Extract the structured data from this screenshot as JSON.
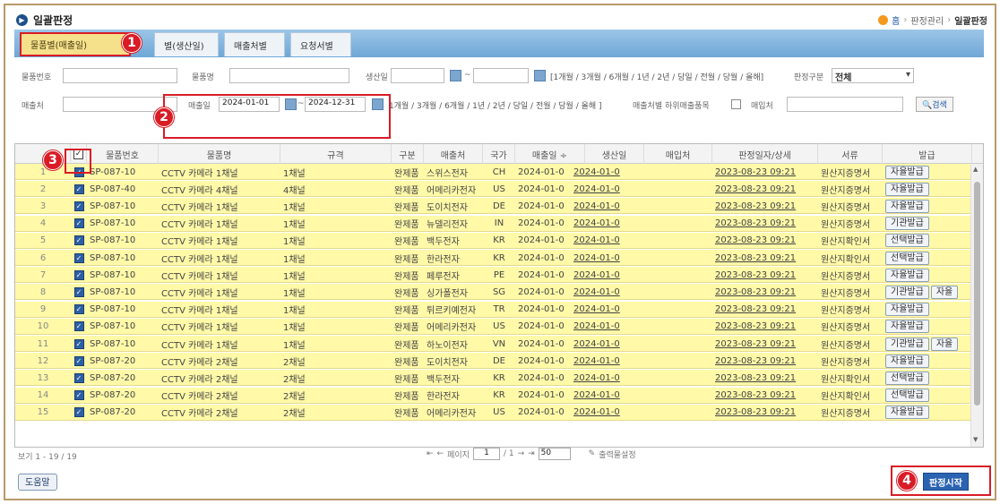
{
  "header": {
    "title": "일괄판정",
    "breadcrumb": {
      "home": "홈",
      "section": "판정관리",
      "current": "일괄판정"
    }
  },
  "tabs": [
    {
      "label": "물품별(매출일)"
    },
    {
      "label": "별(생산일)"
    },
    {
      "label": "매출처별"
    },
    {
      "label": "요청서별"
    }
  ],
  "badges": {
    "b1": "1",
    "b2": "2",
    "b3": "3",
    "b4": "4"
  },
  "filters": {
    "item_no_label": "물품번호",
    "item_name_label": "물품명",
    "prod_date_label": "생산일",
    "tilde": "~",
    "quick_ranges": "[1개월 / 3개월 / 6개월 / 1년 / 2년 / 당일 / 전월 / 당월 / 올해]",
    "judge_type_label": "판정구분",
    "judge_type_value": "전체",
    "buyer_label": "매출처",
    "sale_date_label": "매출일",
    "sale_date_from": "2024-01-01",
    "sale_date_to": "2024-12-31",
    "quick_ranges2": "1개월 / 3개월 / 6개월 / 1년 / 2년 / 당일 / 전월 / 당월 / 올해 ]",
    "sub_buyer_label": "매출처별 하위매출품목",
    "purchaser_label": "매입처",
    "search_label": "검색"
  },
  "grid": {
    "columns": [
      "물품번호",
      "물품명",
      "규격",
      "구분",
      "매출처",
      "국가",
      "매출일 ÷",
      "생산일",
      "매입처",
      "판정일자/상세",
      "서류",
      "발급"
    ],
    "rows": [
      {
        "n": "1",
        "item_no": "SP-087-10",
        "name": "CCTV 카메라 1채널",
        "spec": "1채널",
        "type": "완제품",
        "buyer": "스위스전자",
        "country": "CH",
        "sale": "2024-01-0",
        "prod": "2024-01-0",
        "judged": "2023-08-23 09:21",
        "doc": "원산지증명서",
        "issue": [
          "자율발급"
        ]
      },
      {
        "n": "2",
        "item_no": "SP-087-40",
        "name": "CCTV 카메라 4채널",
        "spec": "4채널",
        "type": "완제품",
        "buyer": "어메리카전자",
        "country": "US",
        "sale": "2024-01-0",
        "prod": "2024-01-0",
        "judged": "2023-08-23 09:21",
        "doc": "원산지증명서",
        "issue": [
          "자율발급"
        ]
      },
      {
        "n": "3",
        "item_no": "SP-087-10",
        "name": "CCTV 카메라 1채널",
        "spec": "1채널",
        "type": "완제품",
        "buyer": "도이치전자",
        "country": "DE",
        "sale": "2024-01-0",
        "prod": "2024-01-0",
        "judged": "2023-08-23 09:21",
        "doc": "원산지증명서",
        "issue": [
          "자율발급"
        ]
      },
      {
        "n": "4",
        "item_no": "SP-087-10",
        "name": "CCTV 카메라 1채널",
        "spec": "1채널",
        "type": "완제품",
        "buyer": "뉴델리전자",
        "country": "IN",
        "sale": "2024-01-0",
        "prod": "2024-01-0",
        "judged": "2023-08-23 09:21",
        "doc": "원산지증명서",
        "issue": [
          "기관발급"
        ]
      },
      {
        "n": "5",
        "item_no": "SP-087-10",
        "name": "CCTV 카메라 1채널",
        "spec": "1채널",
        "type": "완제품",
        "buyer": "백두전자",
        "country": "KR",
        "sale": "2024-01-0",
        "prod": "2024-01-0",
        "judged": "2023-08-23 09:21",
        "doc": "원산지확인서",
        "issue": [
          "선택발급"
        ]
      },
      {
        "n": "6",
        "item_no": "SP-087-10",
        "name": "CCTV 카메라 1채널",
        "spec": "1채널",
        "type": "완제품",
        "buyer": "한라전자",
        "country": "KR",
        "sale": "2024-01-0",
        "prod": "2024-01-0",
        "judged": "2023-08-23 09:21",
        "doc": "원산지확인서",
        "issue": [
          "선택발급"
        ]
      },
      {
        "n": "7",
        "item_no": "SP-087-10",
        "name": "CCTV 카메라 1채널",
        "spec": "1채널",
        "type": "완제품",
        "buyer": "페루전자",
        "country": "PE",
        "sale": "2024-01-0",
        "prod": "2024-01-0",
        "judged": "2023-08-23 09:21",
        "doc": "원산지증명서",
        "issue": [
          "자율발급"
        ]
      },
      {
        "n": "8",
        "item_no": "SP-087-10",
        "name": "CCTV 카메라 1채널",
        "spec": "1채널",
        "type": "완제품",
        "buyer": "싱가폴전자",
        "country": "SG",
        "sale": "2024-01-0",
        "prod": "2024-01-0",
        "judged": "2023-08-23 09:21",
        "doc": "원산지증명서",
        "issue": [
          "기관발급",
          "자율"
        ]
      },
      {
        "n": "9",
        "item_no": "SP-087-10",
        "name": "CCTV 카메라 1채널",
        "spec": "1채널",
        "type": "완제품",
        "buyer": "튀르키예전자",
        "country": "TR",
        "sale": "2024-01-0",
        "prod": "2024-01-0",
        "judged": "2023-08-23 09:21",
        "doc": "원산지증명서",
        "issue": [
          "자율발급"
        ]
      },
      {
        "n": "10",
        "item_no": "SP-087-10",
        "name": "CCTV 카메라 1채널",
        "spec": "1채널",
        "type": "완제품",
        "buyer": "어메리카전자",
        "country": "US",
        "sale": "2024-01-0",
        "prod": "2024-01-0",
        "judged": "2023-08-23 09:21",
        "doc": "원산지증명서",
        "issue": [
          "자율발급"
        ]
      },
      {
        "n": "11",
        "item_no": "SP-087-10",
        "name": "CCTV 카메라 1채널",
        "spec": "1채널",
        "type": "완제품",
        "buyer": "하노이전자",
        "country": "VN",
        "sale": "2024-01-0",
        "prod": "2024-01-0",
        "judged": "2023-08-23 09:21",
        "doc": "원산지증명서",
        "issue": [
          "기관발급",
          "자율"
        ]
      },
      {
        "n": "12",
        "item_no": "SP-087-20",
        "name": "CCTV 카메라 2채널",
        "spec": "2채널",
        "type": "완제품",
        "buyer": "도이치전자",
        "country": "DE",
        "sale": "2024-01-0",
        "prod": "2024-01-0",
        "judged": "2023-08-23 09:21",
        "doc": "원산지증명서",
        "issue": [
          "자율발급"
        ]
      },
      {
        "n": "13",
        "item_no": "SP-087-20",
        "name": "CCTV 카메라 2채널",
        "spec": "2채널",
        "type": "완제품",
        "buyer": "백두전자",
        "country": "KR",
        "sale": "2024-01-0",
        "prod": "2024-01-0",
        "judged": "2023-08-23 09:21",
        "doc": "원산지확인서",
        "issue": [
          "선택발급"
        ]
      },
      {
        "n": "14",
        "item_no": "SP-087-20",
        "name": "CCTV 카메라 2채널",
        "spec": "2채널",
        "type": "완제품",
        "buyer": "한라전자",
        "country": "KR",
        "sale": "2024-01-0",
        "prod": "2024-01-0",
        "judged": "2023-08-23 09:21",
        "doc": "원산지확인서",
        "issue": [
          "선택발급"
        ]
      },
      {
        "n": "15",
        "item_no": "SP-087-20",
        "name": "CCTV 카메라 2채널",
        "spec": "2채널",
        "type": "완제품",
        "buyer": "어메리카전자",
        "country": "US",
        "sale": "2024-01-0",
        "prod": "2024-01-0",
        "judged": "2023-08-23 09:21",
        "doc": "원산지증명서",
        "issue": [
          "자율발급"
        ]
      }
    ]
  },
  "footer": {
    "view_count": "보기 1 - 19 / 19",
    "page_label": "페이지",
    "page_value": "1",
    "page_total": "/ 1",
    "page_size": "50",
    "export_label": "출력물설정"
  },
  "buttons": {
    "help": "도움말",
    "start": "판정시작"
  },
  "colors": {
    "row_bg": "#fff9a8",
    "accent": "#d91c26",
    "tab_bar": "#7fb0da"
  }
}
